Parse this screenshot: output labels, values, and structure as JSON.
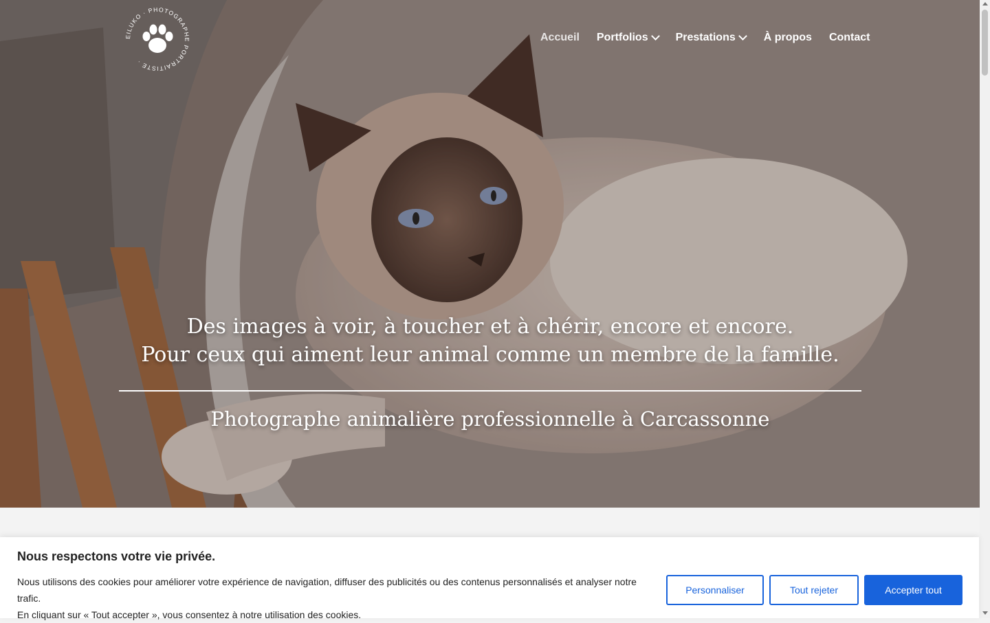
{
  "logo": {
    "ring_text": "EILUKO · PHOTOGRAPHE PORTRAITISTE ·",
    "icon": "paw-print-icon"
  },
  "nav": {
    "items": [
      {
        "label": "Accueil",
        "has_dropdown": false
      },
      {
        "label": "Portfolios",
        "has_dropdown": true
      },
      {
        "label": "Prestations",
        "has_dropdown": true
      },
      {
        "label": "À propos",
        "has_dropdown": false
      },
      {
        "label": "Contact",
        "has_dropdown": false
      }
    ]
  },
  "hero": {
    "tagline_line1": "Des images à voir, à toucher et à chérir, encore et encore.",
    "tagline_line2": "Pour ceux qui aiment leur animal comme un membre de la famille.",
    "subtitle": "Photographe animalière professionnelle à Carcassonne"
  },
  "cookie": {
    "title": "Nous respectons votre vie privée.",
    "text_line1": "Nous utilisons des cookies pour améliorer votre expérience de navigation, diffuser des publicités ou des contenus personnalisés et analyser notre trafic.",
    "text_line2": "En cliquant sur « Tout accepter », vous consentez à notre utilisation des cookies.",
    "customize_label": "Personnaliser",
    "reject_label": "Tout rejeter",
    "accept_label": "Accepter tout"
  },
  "colors": {
    "accent": "#1863dc",
    "hero_text": "#ffffff"
  }
}
